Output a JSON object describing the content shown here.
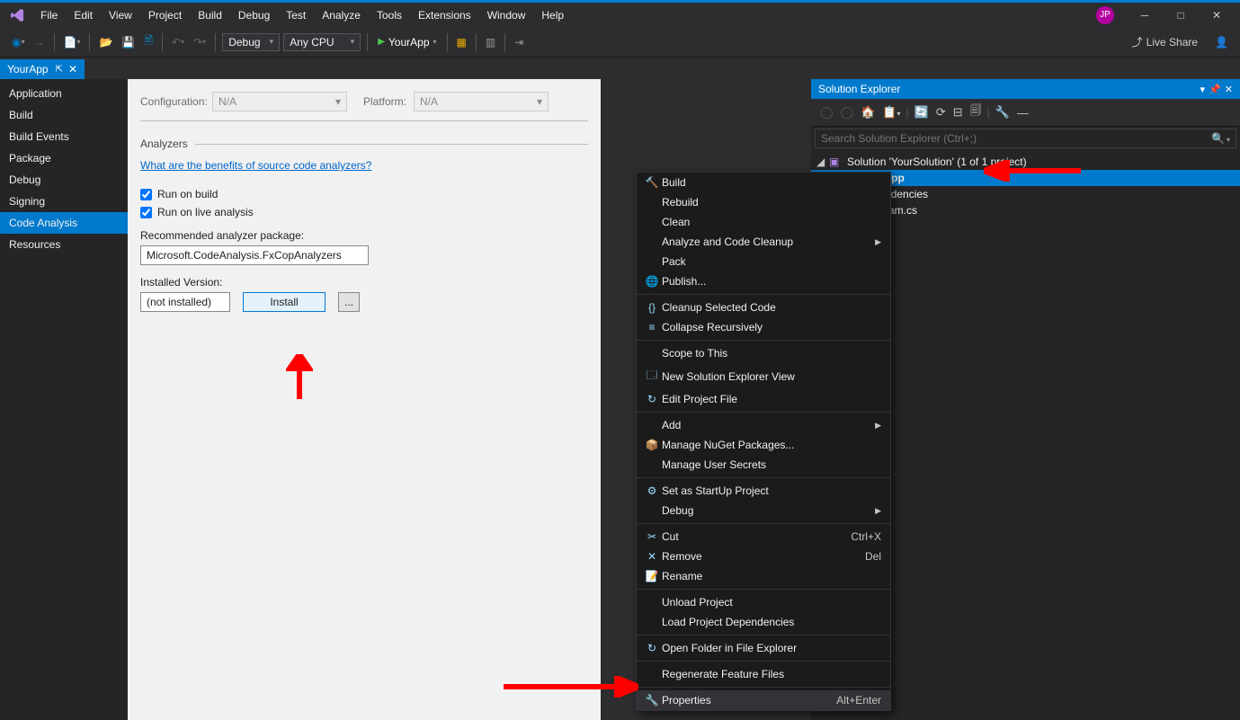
{
  "menu": [
    "File",
    "Edit",
    "View",
    "Project",
    "Build",
    "Debug",
    "Test",
    "Analyze",
    "Tools",
    "Extensions",
    "Window",
    "Help"
  ],
  "avatar": "JP",
  "toolbar": {
    "config": "Debug",
    "platform": "Any CPU",
    "start": "YourApp",
    "liveshare": "Live Share"
  },
  "docTab": "YourApp",
  "leftNav": [
    "Application",
    "Build",
    "Build Events",
    "Package",
    "Debug",
    "Signing",
    "Code Analysis",
    "Resources"
  ],
  "leftNavSelected": 6,
  "propPanel": {
    "configLabel": "Configuration:",
    "configValue": "N/A",
    "platLabel": "Platform:",
    "platValue": "N/A",
    "section": "Analyzers",
    "link": "What are the benefits of source code analyzers?",
    "chk1": "Run on build",
    "chk2": "Run on live analysis",
    "recLabel": "Recommended analyzer package:",
    "recVal": "Microsoft.CodeAnalysis.FxCopAnalyzers",
    "instLabel": "Installed Version:",
    "instVal": "(not installed)",
    "installBtn": "Install",
    "dotsBtn": "..."
  },
  "solExplorer": {
    "title": "Solution Explorer",
    "searchPlaceholder": "Search Solution Explorer (Ctrl+;)",
    "solution": "Solution 'YourSolution' (1 of 1 project)",
    "project": "YourApp",
    "deps": "Dependencies",
    "program": "Program.cs"
  },
  "ctx": {
    "items": [
      {
        "ico": "🔨",
        "lbl": "Build"
      },
      {
        "lbl": "Rebuild"
      },
      {
        "lbl": "Clean"
      },
      {
        "lbl": "Analyze and Code Cleanup",
        "sub": true
      },
      {
        "lbl": "Pack"
      },
      {
        "ico": "🌐",
        "lbl": "Publish..."
      },
      {
        "sep": true
      },
      {
        "ico": "{}",
        "lbl": "Cleanup Selected Code"
      },
      {
        "ico": "≡",
        "lbl": "Collapse Recursively"
      },
      {
        "sep": true
      },
      {
        "lbl": "Scope to This"
      },
      {
        "ico": "🗔",
        "lbl": "New Solution Explorer View"
      },
      {
        "ico": "↻",
        "lbl": "Edit Project File"
      },
      {
        "sep": true
      },
      {
        "lbl": "Add",
        "sub": true
      },
      {
        "ico": "📦",
        "lbl": "Manage NuGet Packages..."
      },
      {
        "lbl": "Manage User Secrets"
      },
      {
        "sep": true
      },
      {
        "ico": "⚙",
        "lbl": "Set as StartUp Project"
      },
      {
        "lbl": "Debug",
        "sub": true
      },
      {
        "sep": true
      },
      {
        "ico": "✂",
        "lbl": "Cut",
        "short": "Ctrl+X"
      },
      {
        "ico": "✕",
        "lbl": "Remove",
        "short": "Del"
      },
      {
        "ico": "📝",
        "lbl": "Rename"
      },
      {
        "sep": true
      },
      {
        "lbl": "Unload Project"
      },
      {
        "lbl": "Load Project Dependencies"
      },
      {
        "sep": true
      },
      {
        "ico": "↻",
        "lbl": "Open Folder in File Explorer"
      },
      {
        "sep": true
      },
      {
        "lbl": "Regenerate Feature Files"
      },
      {
        "sep": true
      },
      {
        "ico": "🔧",
        "lbl": "Properties",
        "short": "Alt+Enter",
        "hl": true
      }
    ]
  }
}
